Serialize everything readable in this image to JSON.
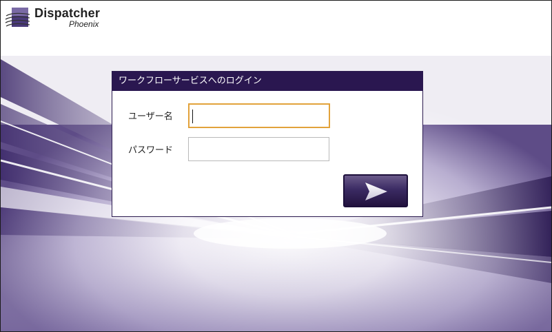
{
  "logo": {
    "name": "Dispatcher",
    "product": "Phoenix"
  },
  "login": {
    "title": "ワークフローサービスへのログイン",
    "username_label": "ユーザー名",
    "username_value": "",
    "password_label": "パスワード",
    "password_value": "",
    "submit_icon": "arrow-right-icon"
  },
  "colors": {
    "title_bar": "#2a1750",
    "focus_border": "#e2a23a",
    "accent_purple": "#3b2b63"
  }
}
